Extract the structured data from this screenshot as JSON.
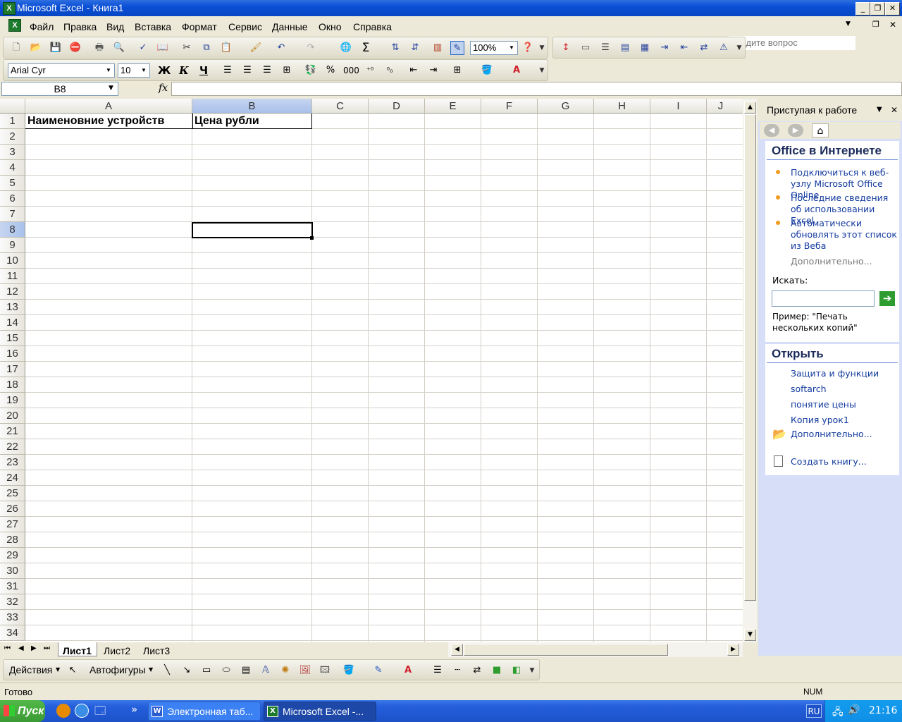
{
  "window": {
    "title": "Microsoft Excel - Книга1"
  },
  "menu": [
    "Файл",
    "Правка",
    "Вид",
    "Вставка",
    "Формат",
    "Сервис",
    "Данные",
    "Окно",
    "Справка"
  ],
  "ask_placeholder": "Введите вопрос",
  "toolbar": {
    "zoom": "100%",
    "font": "Arial Cyr",
    "size": "10",
    "bold": "Ж",
    "italic": "К",
    "underline": "Ч",
    "percent": "%",
    "thousands": "000",
    "sigma": "Σ"
  },
  "namebox": "B8",
  "fx": "fx",
  "columns": [
    "A",
    "B",
    "C",
    "D",
    "E",
    "F",
    "G",
    "H",
    "I",
    "J"
  ],
  "rows": [
    "1",
    "2",
    "3",
    "4",
    "5",
    "6",
    "7",
    "8",
    "9",
    "10",
    "11",
    "12",
    "13",
    "14",
    "15",
    "16",
    "17",
    "18",
    "19",
    "20",
    "21",
    "22",
    "23",
    "24",
    "25",
    "26",
    "27",
    "28",
    "29",
    "30",
    "31",
    "32",
    "33",
    "34"
  ],
  "cells": {
    "A1": "Наименовние устройств",
    "B1": "Цена рубли"
  },
  "taskpane": {
    "title": "Приступая к работе",
    "section1": "Office в Интернете",
    "links1": [
      "Подключиться к веб-узлу Microsoft Office Online",
      "Последние сведения об использовании Excel",
      "Автоматически обновлять этот список из Веба"
    ],
    "more1": "Дополнительно...",
    "search_label": "Искать:",
    "example": "Пример:  \"Печать нескольких копий\"",
    "section2": "Открыть",
    "files": [
      "Защита и функции",
      "softarch",
      "понятие цены",
      "Копия урок1"
    ],
    "more2": "Дополнительно...",
    "create": "Создать книгу..."
  },
  "sheets": [
    "Лист1",
    "Лист2",
    "Лист3"
  ],
  "drawing": {
    "actions": "Действия",
    "autoshapes": "Автофигуры"
  },
  "status": {
    "ready": "Готово",
    "num": "NUM"
  },
  "taskbar": {
    "start": "Пуск",
    "btn1": "Электронная таб...",
    "btn2": "Microsoft Excel -...",
    "lang": "RU",
    "clock": "21:16",
    "more": "»"
  }
}
